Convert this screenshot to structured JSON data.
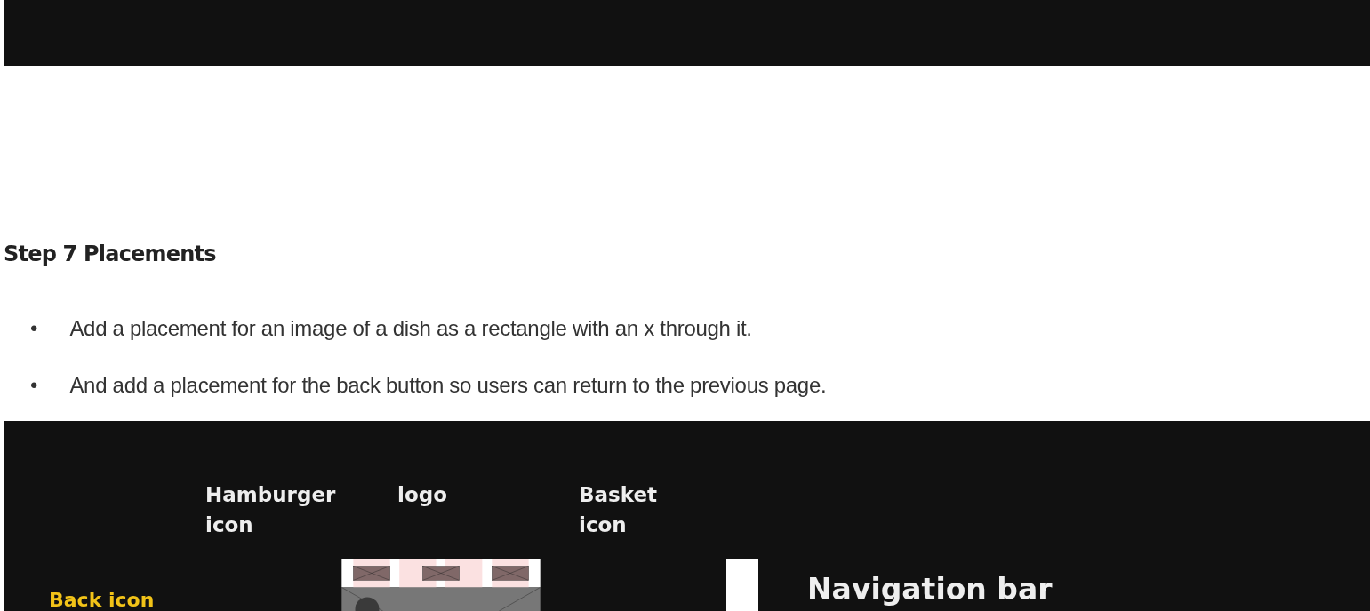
{
  "step": {
    "title": "Step 7 Placements",
    "bullets": [
      {
        "marker": "•",
        "text": "Add a placement for an image of a dish as a rectangle with an x through it."
      },
      {
        "marker": "•",
        "text": "And add a placement for the back button so users can return to the previous page."
      }
    ]
  },
  "diagram": {
    "labels": [
      "Hamburger icon",
      "logo",
      "Basket icon"
    ],
    "side_label": "Back icon",
    "section_title": "Navigation bar"
  }
}
